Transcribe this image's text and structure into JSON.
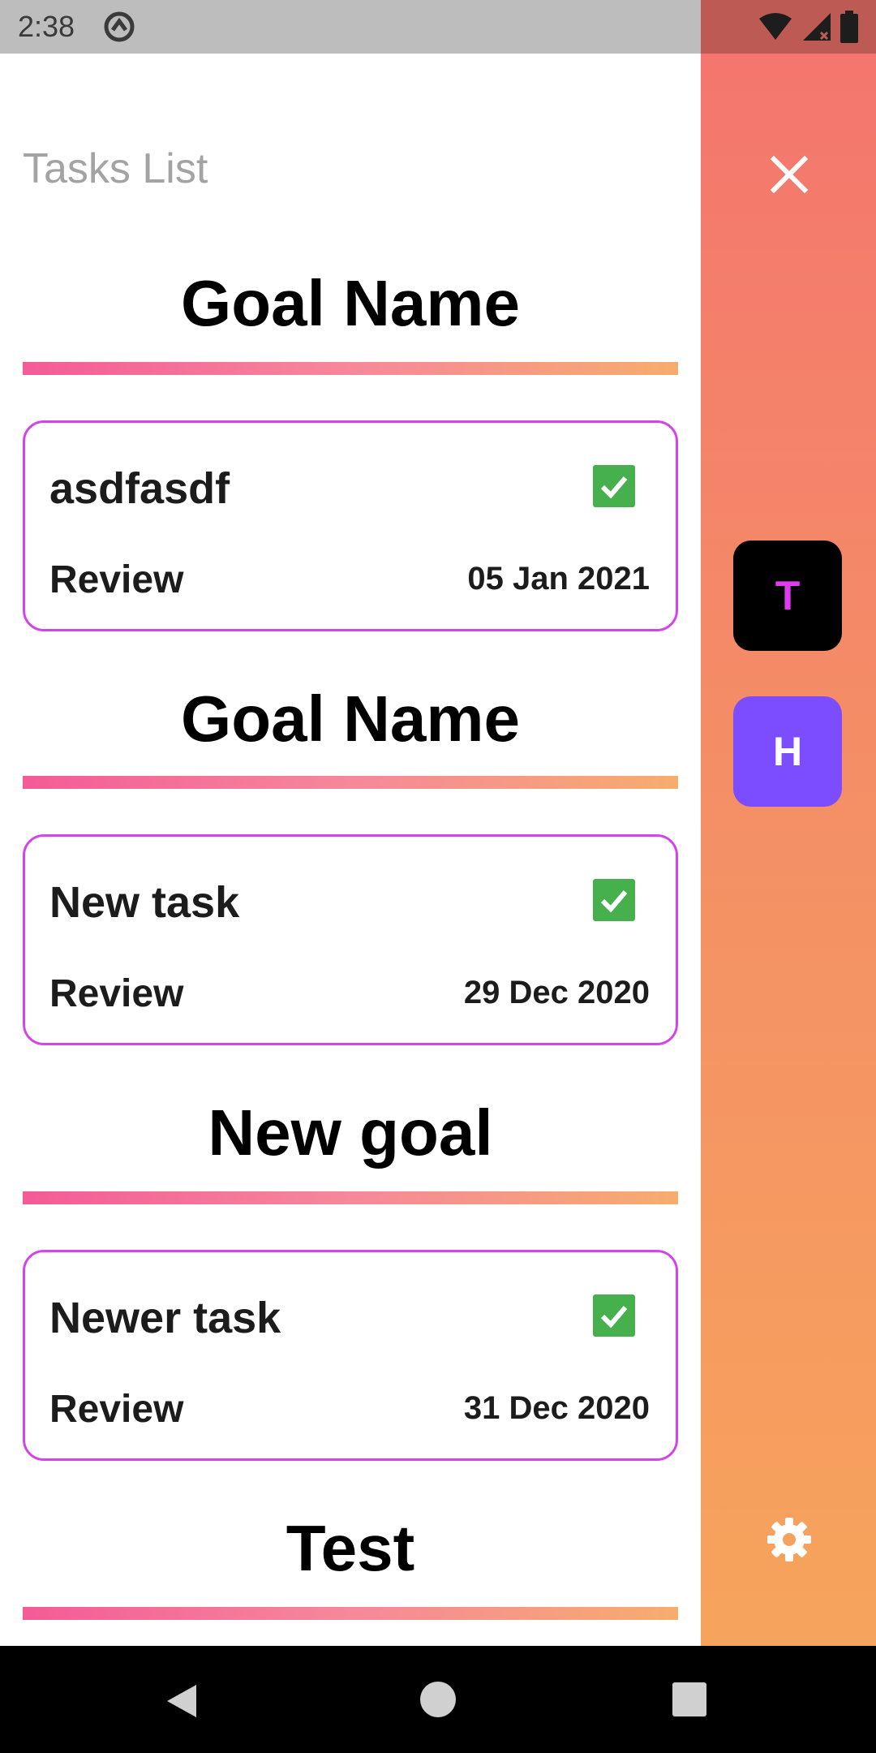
{
  "status_bar": {
    "time": "2:38"
  },
  "page": {
    "title": "Tasks List"
  },
  "groups": [
    {
      "goal": "Goal Name",
      "task": {
        "name": "asdfasdf",
        "status": "Review",
        "date": "05 Jan 2021",
        "done": true
      }
    },
    {
      "goal": "Goal Name",
      "task": {
        "name": "New task",
        "status": "Review",
        "date": "29 Dec 2020",
        "done": true
      }
    },
    {
      "goal": "New goal",
      "task": {
        "name": "Newer task",
        "status": "Review",
        "date": "31 Dec 2020",
        "done": true
      }
    },
    {
      "goal": "Test"
    }
  ],
  "side_panel": {
    "close_icon": "close-icon",
    "avatars": [
      {
        "letter": "T",
        "bg": "#000000",
        "fg": "#e03bf0"
      },
      {
        "letter": "H",
        "bg": "#7c4dff",
        "fg": "#ffffff"
      }
    ],
    "settings_icon": "gear-icon"
  },
  "colors": {
    "card_border": "#d444ec",
    "check": "#46b04d",
    "panel_top": "#f4766e",
    "panel_bottom": "#f6a45c"
  }
}
